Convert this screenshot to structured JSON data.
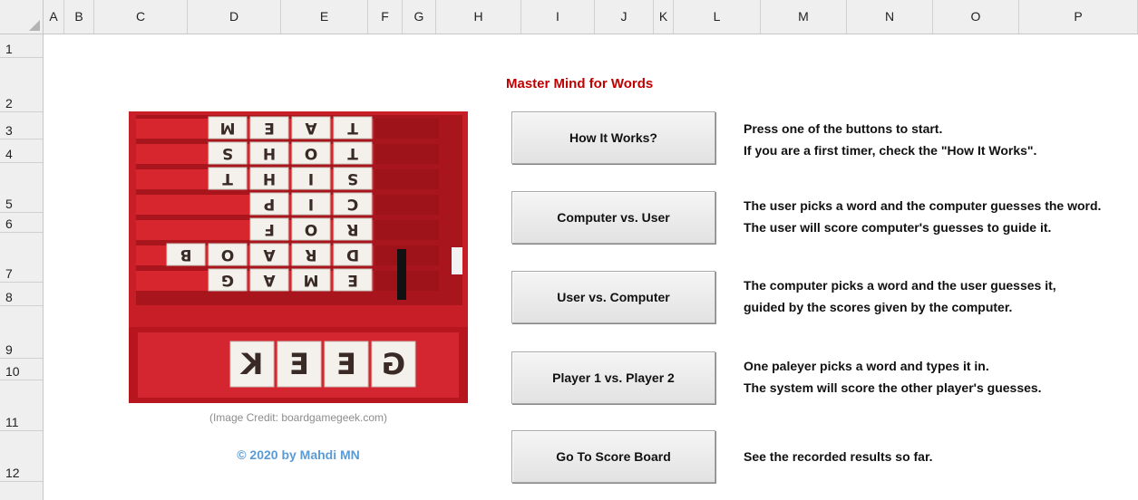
{
  "sheet": {
    "columns": [
      "A",
      "B",
      "C",
      "D",
      "E",
      "F",
      "G",
      "H",
      "I",
      "J",
      "K",
      "L",
      "M",
      "N",
      "O",
      "P"
    ],
    "rows": [
      "1",
      "2",
      "3",
      "4",
      "5",
      "6",
      "7",
      "8",
      "9",
      "10",
      "11",
      "12"
    ]
  },
  "title": "Master Mind for Words",
  "buttons": [
    {
      "label": "How It Works?",
      "desc": [
        "Press one of the buttons to start.",
        "If you are a first timer, check the \"How It Works\"."
      ]
    },
    {
      "label": "Computer vs. User",
      "desc": [
        "The user picks a word and the computer guesses the word.",
        "The user will score computer's guesses to guide it."
      ]
    },
    {
      "label": "User vs. Computer",
      "desc": [
        "The computer picks a word and the user guesses it,",
        "guided by the scores given by the computer."
      ]
    },
    {
      "label": "Player 1 vs. Player 2",
      "desc": [
        "One paleyer picks a word and types it in.",
        "The system will score the other player's guesses."
      ]
    },
    {
      "label": "Go To Score Board",
      "desc": [
        "See the recorded results so far."
      ]
    }
  ],
  "image": {
    "credit": "(Image Credit: boardgamegeek.com)",
    "tile_rows": [
      [
        "M",
        "E",
        "A",
        "T"
      ],
      [
        "S",
        "H",
        "O",
        "T"
      ],
      [
        "T",
        "H",
        "I",
        "S"
      ],
      [
        "P",
        "I",
        "C"
      ],
      [
        "F",
        "O",
        "R"
      ],
      [
        "B",
        "O",
        "A",
        "R",
        "D"
      ],
      [
        "G",
        "A",
        "M",
        "E"
      ]
    ],
    "bottom_tiles": [
      "G",
      "E",
      "E",
      "K"
    ],
    "board_color": "#b81820"
  },
  "copyright": "© 2020 by Mahdi MN"
}
